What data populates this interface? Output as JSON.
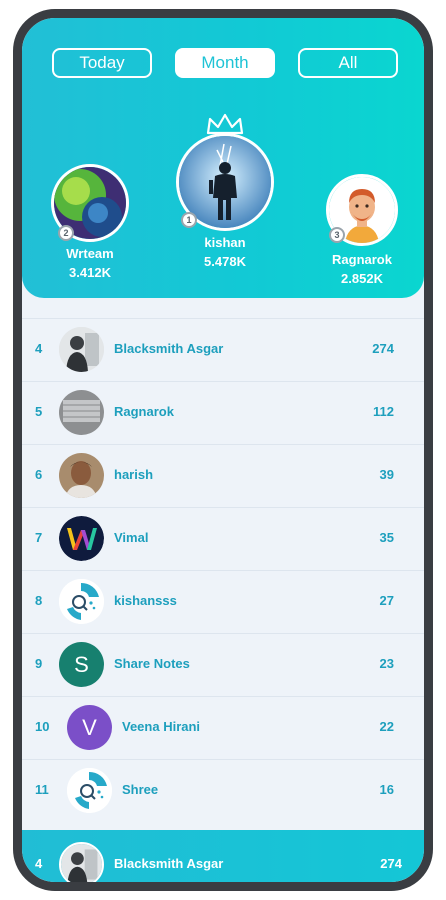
{
  "tabs": [
    {
      "label": "Today",
      "active": false
    },
    {
      "label": "Month",
      "active": true
    },
    {
      "label": "All",
      "active": false
    }
  ],
  "top3": {
    "first": {
      "rank": "1",
      "name": "kishan",
      "score": "5.478K"
    },
    "second": {
      "rank": "2",
      "name": "Wrteam",
      "score": "3.412K"
    },
    "third": {
      "rank": "3",
      "name": "Ragnarok",
      "score": "2.852K"
    }
  },
  "leaderboard": [
    {
      "rank": "4",
      "name": "Blacksmith Asgar",
      "score": "274",
      "avatar": "photo-bw"
    },
    {
      "rank": "5",
      "name": "Ragnarok",
      "score": "112",
      "avatar": "photo-gray"
    },
    {
      "rank": "6",
      "name": "harish",
      "score": "39",
      "avatar": "photo-face"
    },
    {
      "rank": "7",
      "name": "Vimal",
      "score": "35",
      "avatar": "w-logo"
    },
    {
      "rank": "8",
      "name": "kishansss",
      "score": "27",
      "avatar": "q-logo"
    },
    {
      "rank": "9",
      "name": "Share Notes",
      "score": "23",
      "avatar": "letter",
      "letter": "S"
    },
    {
      "rank": "10",
      "name": "Veena Hirani",
      "score": "22",
      "avatar": "letter",
      "letter": "V"
    },
    {
      "rank": "11",
      "name": "Shree",
      "score": "16",
      "avatar": "q-logo"
    }
  ],
  "current_user": {
    "rank": "4",
    "name": "Blacksmith Asgar",
    "score": "274"
  },
  "colors": {
    "header_gradient_start": "#22bfd6",
    "header_gradient_end": "#0ad6d0",
    "text_accent": "#1d9fbd",
    "avatar_S": "#17806f",
    "avatar_V": "#7b4fc8"
  }
}
